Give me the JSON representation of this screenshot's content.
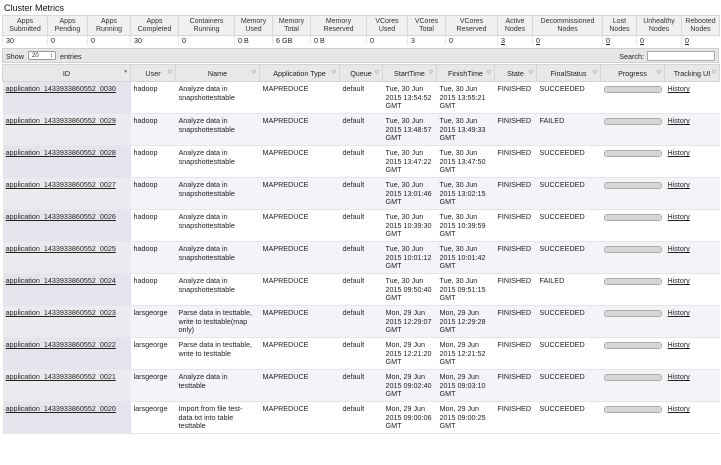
{
  "page_title": "Cluster Metrics",
  "metrics": {
    "headers": [
      "Apps\nSubmitted",
      "Apps\nPending",
      "Apps\nRunning",
      "Apps\nCompleted",
      "Containers\nRunning",
      "Memory\nUsed",
      "Memory\nTotal",
      "Memory\nReserved",
      "VCores\nUsed",
      "VCores\nTotal",
      "VCores\nReserved",
      "Active\nNodes",
      "Decommissioned\nNodes",
      "Lost\nNodes",
      "Unhealthy\nNodes",
      "Rebooted\nNodes"
    ],
    "values": [
      "30",
      "0",
      "0",
      "30",
      "0",
      "0 B",
      "6 GB",
      "0 B",
      "0",
      "3",
      "0",
      "3",
      "0",
      "0",
      "0",
      "0"
    ],
    "links": [
      false,
      false,
      false,
      false,
      false,
      false,
      false,
      false,
      false,
      false,
      false,
      true,
      true,
      true,
      true,
      true
    ]
  },
  "controls": {
    "show_label": "Show",
    "entries_value": "20",
    "entries_label": "entries",
    "search_label": "Search:",
    "search_value": ""
  },
  "columns": [
    "ID",
    "User",
    "Name",
    "Application Type",
    "Queue",
    "StartTime",
    "FinishTime",
    "State",
    "FinalStatus",
    "Progress",
    "Tracking UI"
  ],
  "rows": [
    {
      "id": "application_1433933860552_0030",
      "user": "hadoop",
      "name": "Analyze data in snapshottesttable",
      "type": "MAPREDUCE",
      "queue": "default",
      "start": "Tue, 30 Jun 2015 13:54:52 GMT",
      "finish": "Tue, 30 Jun 2015 13:55:21 GMT",
      "state": "FINISHED",
      "final": "SUCCEEDED",
      "progress": 1.0,
      "tracking": "History"
    },
    {
      "id": "application_1433933860552_0029",
      "user": "hadoop",
      "name": "Analyze data in snapshottesttable",
      "type": "MAPREDUCE",
      "queue": "default",
      "start": "Tue, 30 Jun 2015 13:48:57 GMT",
      "finish": "Tue, 30 Jun 2015 13:49:33 GMT",
      "state": "FINISHED",
      "final": "FAILED",
      "progress": 1.0,
      "tracking": "History"
    },
    {
      "id": "application_1433933860552_0028",
      "user": "hadoop",
      "name": "Analyze data in snapshottesttable",
      "type": "MAPREDUCE",
      "queue": "default",
      "start": "Tue, 30 Jun 2015 13:47:22 GMT",
      "finish": "Tue, 30 Jun 2015 13:47:50 GMT",
      "state": "FINISHED",
      "final": "SUCCEEDED",
      "progress": 1.0,
      "tracking": "History"
    },
    {
      "id": "application_1433933860552_0027",
      "user": "hadoop",
      "name": "Analyze data in snapshottesttable",
      "type": "MAPREDUCE",
      "queue": "default",
      "start": "Tue, 30 Jun 2015 13:01:46 GMT",
      "finish": "Tue, 30 Jun 2015 13:02:15 GMT",
      "state": "FINISHED",
      "final": "SUCCEEDED",
      "progress": 1.0,
      "tracking": "History"
    },
    {
      "id": "application_1433933860552_0026",
      "user": "hadoop",
      "name": "Analyze data in snapshottesttable",
      "type": "MAPREDUCE",
      "queue": "default",
      "start": "Tue, 30 Jun 2015 10:39:30 GMT",
      "finish": "Tue, 30 Jun 2015 10:39:59 GMT",
      "state": "FINISHED",
      "final": "SUCCEEDED",
      "progress": 1.0,
      "tracking": "History"
    },
    {
      "id": "application_1433933860552_0025",
      "user": "hadoop",
      "name": "Analyze data in snapshottesttable",
      "type": "MAPREDUCE",
      "queue": "default",
      "start": "Tue, 30 Jun 2015 10:01:12 GMT",
      "finish": "Tue, 30 Jun 2015 10:01:42 GMT",
      "state": "FINISHED",
      "final": "SUCCEEDED",
      "progress": 1.0,
      "tracking": "History"
    },
    {
      "id": "application_1433933860552_0024",
      "user": "hadoop",
      "name": "Analyze data in snapshottesttable",
      "type": "MAPREDUCE",
      "queue": "default",
      "start": "Tue, 30 Jun 2015 09:50:40 GMT",
      "finish": "Tue, 30 Jun 2015 09:51:15 GMT",
      "state": "FINISHED",
      "final": "FAILED",
      "progress": 1.0,
      "tracking": "History"
    },
    {
      "id": "application_1433933860552_0023",
      "user": "larsgeorge",
      "name": "Parse data in testtable, write to testtable(map only)",
      "type": "MAPREDUCE",
      "queue": "default",
      "start": "Mon, 29 Jun 2015 12:29:07 GMT",
      "finish": "Mon, 29 Jun 2015 12:29:28 GMT",
      "state": "FINISHED",
      "final": "SUCCEEDED",
      "progress": 1.0,
      "tracking": "History"
    },
    {
      "id": "application_1433933860552_0022",
      "user": "larsgeorge",
      "name": "Parse data in testtable, write to testtable",
      "type": "MAPREDUCE",
      "queue": "default",
      "start": "Mon, 29 Jun 2015 12:21:20 GMT",
      "finish": "Mon, 29 Jun 2015 12:21:52 GMT",
      "state": "FINISHED",
      "final": "SUCCEEDED",
      "progress": 1.0,
      "tracking": "History"
    },
    {
      "id": "application_1433933860552_0021",
      "user": "larsgeorge",
      "name": "Analyze data in testtable",
      "type": "MAPREDUCE",
      "queue": "default",
      "start": "Mon, 29 Jun 2015 09:02:40 GMT",
      "finish": "Mon, 29 Jun 2015 09:03:10 GMT",
      "state": "FINISHED",
      "final": "SUCCEEDED",
      "progress": 1.0,
      "tracking": "History"
    },
    {
      "id": "application_1433933860552_0020",
      "user": "larsgeorge",
      "name": "Import from file test-data.txt into table testtable",
      "type": "MAPREDUCE",
      "queue": "default",
      "start": "Mon, 29 Jun 2015 09:00:06 GMT",
      "finish": "Mon, 29 Jun 2015 09:00:25 GMT",
      "state": "FINISHED",
      "final": "SUCCEEDED",
      "progress": 1.0,
      "tracking": "History"
    }
  ]
}
